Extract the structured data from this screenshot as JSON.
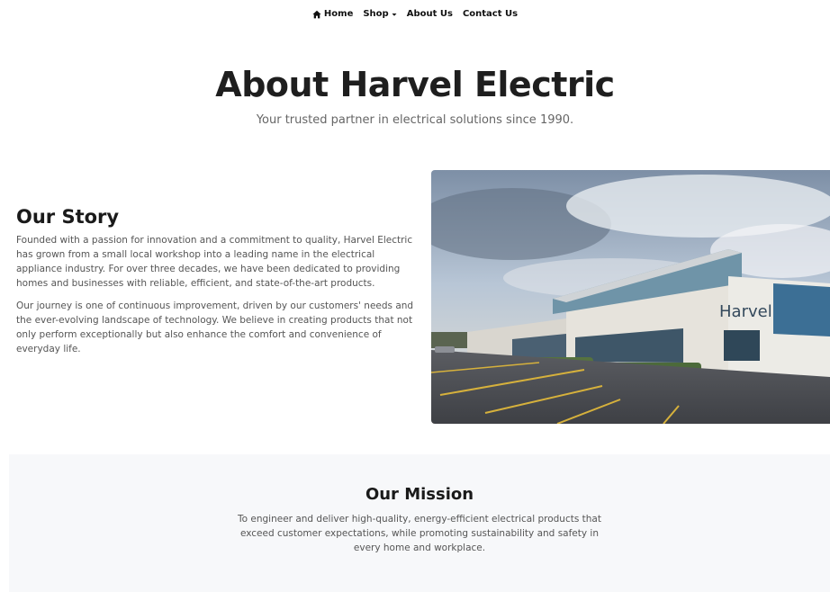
{
  "nav": {
    "items": [
      {
        "label": "Home",
        "icon": "home-icon"
      },
      {
        "label": "Shop",
        "icon": "caret-down-icon"
      },
      {
        "label": "About Us"
      },
      {
        "label": "Contact Us"
      }
    ]
  },
  "hero": {
    "title": "About Harvel Electric",
    "subtitle": "Your trusted partner in electrical solutions since 1990."
  },
  "story": {
    "heading": "Our Story",
    "paragraphs": [
      "Founded with a passion for innovation and a commitment to quality, Harvel Electric has grown from a small local workshop into a leading name in the electrical appliance industry. For over three decades, we have been dedicated to providing homes and businesses with reliable, efficient, and state-of-the-art products.",
      "Our journey is one of continuous improvement, driven by our customers' needs and the ever-evolving landscape of technology. We believe in creating products that not only perform exceptionally but also enhance the comfort and convenience of everyday life."
    ]
  },
  "photo": {
    "sign_text": "Harvel"
  },
  "mission": {
    "heading": "Our Mission",
    "text": "To engineer and deliver high-quality, energy-efficient electrical products that exceed customer expectations, while promoting sustainability and safety in every home and workplace."
  }
}
